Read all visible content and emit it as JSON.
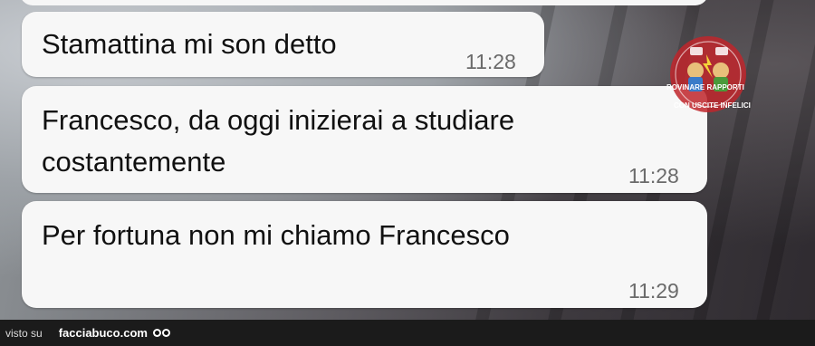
{
  "messages": [
    {
      "text_lines": [
        "Stamattina mi son detto"
      ],
      "time": "11:28"
    },
    {
      "text_lines": [
        "Francesco, da oggi inizierai a studiare",
        "costantemente"
      ],
      "time": "11:28"
    },
    {
      "text_lines": [
        "Per fortuna non mi chiamo Francesco"
      ],
      "time": "11:29"
    }
  ],
  "watermark": {
    "line1": "ROVINARE RAPPORTI",
    "line2": "CON USCITE INFELICI"
  },
  "footer": {
    "visto_su": "visto su",
    "site": "facciabuco.com"
  },
  "colors": {
    "bubble": "#f7f7f7",
    "time": "#6a6a6a",
    "footer_bg": "#1b1b1b",
    "logo_red": "#c0262c"
  }
}
